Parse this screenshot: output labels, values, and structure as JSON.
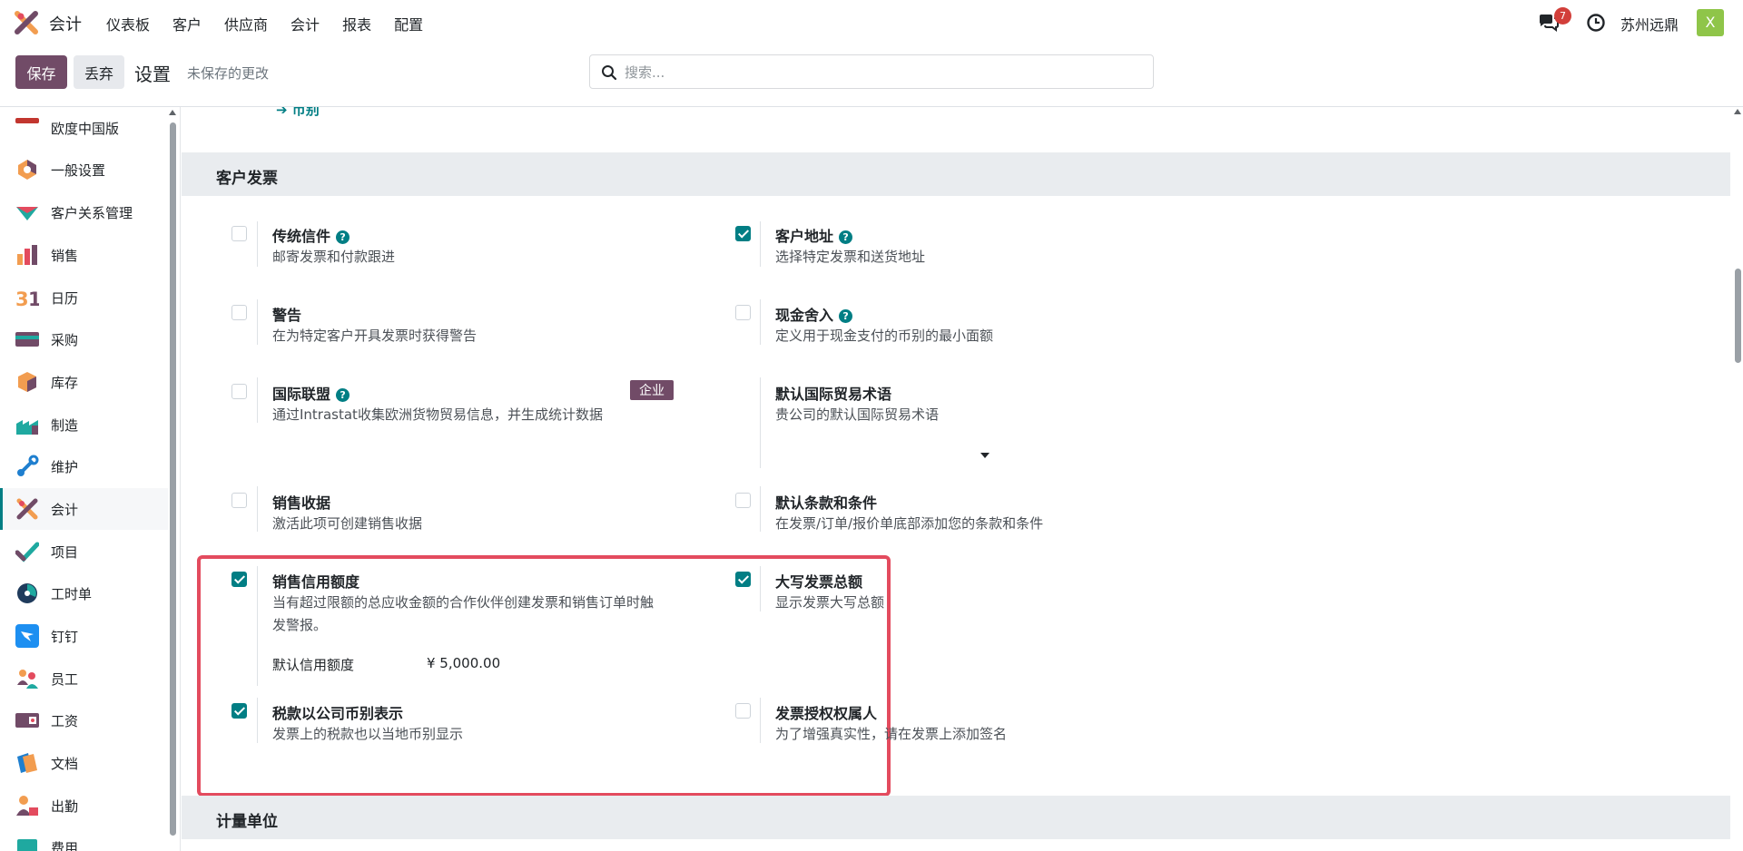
{
  "app": {
    "name": "会计"
  },
  "menu": [
    "仪表板",
    "客户",
    "供应商",
    "会计",
    "报表",
    "配置"
  ],
  "systray": {
    "message_count": "7",
    "company": "苏州远鼎",
    "avatar_letter": "X"
  },
  "control": {
    "save_label": "保存",
    "discard_label": "丢弃",
    "breadcrumb": "设置",
    "unsaved_label": "未保存的更改",
    "search_placeholder": "搜索..."
  },
  "sidebar": {
    "items": [
      {
        "label": "欧度中国版",
        "icon": "odoo-china-icon"
      },
      {
        "label": "一般设置",
        "icon": "general-settings-icon"
      },
      {
        "label": "客户关系管理",
        "icon": "crm-icon"
      },
      {
        "label": "销售",
        "icon": "sales-icon"
      },
      {
        "label": "日历",
        "icon": "calendar-icon"
      },
      {
        "label": "采购",
        "icon": "purchase-icon"
      },
      {
        "label": "库存",
        "icon": "inventory-icon"
      },
      {
        "label": "制造",
        "icon": "manufacturing-icon"
      },
      {
        "label": "维护",
        "icon": "maintenance-icon"
      },
      {
        "label": "会计",
        "icon": "accounting-icon"
      },
      {
        "label": "项目",
        "icon": "project-icon"
      },
      {
        "label": "工时单",
        "icon": "timesheet-icon"
      },
      {
        "label": "钉钉",
        "icon": "dingtalk-icon"
      },
      {
        "label": "员工",
        "icon": "employees-icon"
      },
      {
        "label": "工资",
        "icon": "payroll-icon"
      },
      {
        "label": "文档",
        "icon": "documents-icon"
      },
      {
        "label": "出勤",
        "icon": "attendance-icon"
      },
      {
        "label": "费用",
        "icon": "expenses-icon"
      }
    ],
    "active": "会计"
  },
  "main": {
    "currency_link": "币别",
    "section_customer_invoices": "客户发票",
    "section_uom": "计量单位",
    "enterprise_badge": "企业",
    "default_credit_label": "默认信用额度",
    "default_credit_value": "¥ 5,000.00",
    "settings": {
      "snailmail": {
        "title": "传统信件",
        "desc": "邮寄发票和付款跟进",
        "checked": false
      },
      "customer_address": {
        "title": "客户地址",
        "desc": "选择特定发票和送货地址",
        "checked": true
      },
      "warning": {
        "title": "警告",
        "desc": "在为特定客户开具发票时获得警告",
        "checked": false
      },
      "cash_rounding": {
        "title": "现金舍入",
        "desc": "定义用于现金支付的币别的最小面额",
        "checked": false
      },
      "intrastat": {
        "title": "国际联盟",
        "desc": "通过Intrastat收集欧洲货物贸易信息，并生成统计数据",
        "checked": false
      },
      "incoterm": {
        "title": "默认国际贸易术语",
        "desc": "贵公司的默认国际贸易术语"
      },
      "sales_receipt": {
        "title": "销售收据",
        "desc": "激活此项可创建销售收据",
        "checked": false
      },
      "terms": {
        "title": "默认条款和条件",
        "desc": "在发票/订单/报价单底部添加您的条款和条件",
        "checked": false
      },
      "credit_limit": {
        "title": "销售信用额度",
        "desc_line1": "当有超过限额的总应收金额的合作伙伴创建发票和销售订单时触",
        "desc_line2": "发警报。",
        "checked": true
      },
      "amount_in_words": {
        "title": "大写发票总额",
        "desc": "显示发票大写总额",
        "checked": true
      },
      "tax_company_currency": {
        "title": "税款以公司币别表示",
        "desc": "发票上的税款也以当地币别显示",
        "checked": true
      },
      "invoice_signature": {
        "title": "发票授权权属人",
        "desc": "为了增强真实性，请在发票上添加签名",
        "checked": false
      }
    }
  },
  "colors": {
    "brand": "#714b67",
    "accent": "#017e84",
    "highlight": "#e34b5e"
  }
}
